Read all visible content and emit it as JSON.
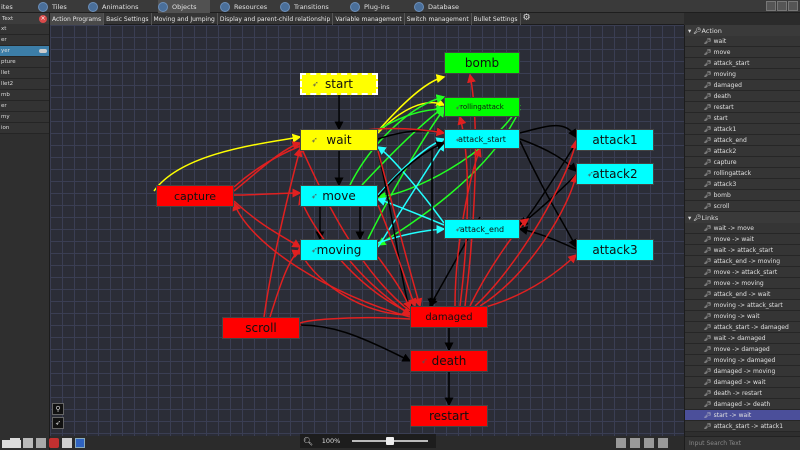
{
  "topbar": {
    "tabs": [
      {
        "label": "ites",
        "icon": "none"
      },
      {
        "label": "Tiles",
        "icon": "tiles-icon"
      },
      {
        "label": "Animations",
        "icon": "animations-icon"
      },
      {
        "label": "Objects",
        "icon": "objects-icon"
      },
      {
        "label": "Resources",
        "icon": "resources-icon"
      },
      {
        "label": "Transitions",
        "icon": "transitions-icon"
      },
      {
        "label": "Plug-ins",
        "icon": "plugins-icon"
      },
      {
        "label": "Database",
        "icon": "database-icon"
      }
    ],
    "active_tab": "Objects"
  },
  "left_panel": {
    "header": "Text",
    "items": [
      "xt",
      "er",
      "yer",
      "pture",
      "llet",
      "llet2",
      "mb",
      "er",
      "my",
      "ion"
    ],
    "selected_index": 2
  },
  "subtabs": {
    "items": [
      "Action Programs",
      "Basic Settings",
      "Moving and Jumping",
      "Display and parent-child relationship",
      "Variable management",
      "Switch management",
      "Bullet Settings"
    ],
    "active_index": 0
  },
  "nodes": {
    "start": {
      "label": "start",
      "color": "#ffff00",
      "size": 12
    },
    "bomb": {
      "label": "bomb",
      "color": "#00ff00",
      "size": 12
    },
    "rollingattack": {
      "label": "rollingattack",
      "color": "#00ff00",
      "size": 7
    },
    "wait": {
      "label": "wait",
      "color": "#ffff00",
      "size": 12
    },
    "attack_start": {
      "label": "attack_start",
      "color": "#00ffff",
      "size": 8
    },
    "attack1": {
      "label": "attack1",
      "color": "#00ffff",
      "size": 12
    },
    "attack2": {
      "label": "attack2",
      "color": "#00ffff",
      "size": 12
    },
    "capture": {
      "label": "capture",
      "color": "#ff0000",
      "size": 11
    },
    "move": {
      "label": "move",
      "color": "#00ffff",
      "size": 12
    },
    "attack_end": {
      "label": "attack_end",
      "color": "#00ffff",
      "size": 8
    },
    "moving": {
      "label": "moving",
      "color": "#00ffff",
      "size": 12
    },
    "attack3": {
      "label": "attack3",
      "color": "#00ffff",
      "size": 12
    },
    "scroll": {
      "label": "scroll",
      "color": "#ff0000",
      "size": 12
    },
    "damaged": {
      "label": "damaged",
      "color": "#ff0000",
      "size": 10
    },
    "death": {
      "label": "death",
      "color": "#ff0000",
      "size": 12
    },
    "restart": {
      "label": "restart",
      "color": "#ff0000",
      "size": 12
    }
  },
  "zoom": {
    "value": "100%",
    "level": 0.5
  },
  "right_panel": {
    "actions_title": "Action",
    "actions": [
      "wait",
      "move",
      "attack_start",
      "moving",
      "damaged",
      "death",
      "restart",
      "start",
      "attack1",
      "attack_end",
      "attack2",
      "capture",
      "rollingattack",
      "attack3",
      "bomb",
      "scroll"
    ],
    "links_title": "Links",
    "links": [
      "wait -> move",
      "move -> wait",
      "wait -> attack_start",
      "attack_end -> moving",
      "move -> attack_start",
      "move -> moving",
      "attack_end -> wait",
      "moving -> attack_start",
      "moving -> wait",
      "attack_start -> damaged",
      "wait -> damaged",
      "move -> damaged",
      "moving -> damaged",
      "damaged -> moving",
      "damaged -> wait",
      "death -> restart",
      "damaged -> death",
      "start -> wait",
      "attack_start -> attack1"
    ],
    "selected_link_index": 17,
    "search_placeholder": "Input Search Text"
  },
  "colors": {
    "canvas_bg": "#2b2d37",
    "grid": "#3a3e53",
    "link_red": "#e02020",
    "link_black": "#000000",
    "link_green": "#22ff22",
    "link_cyan": "#22ffff",
    "link_yellow": "#ffff00",
    "selected_row": "#4b4f9a",
    "left_selected": "#3c7ea8"
  }
}
